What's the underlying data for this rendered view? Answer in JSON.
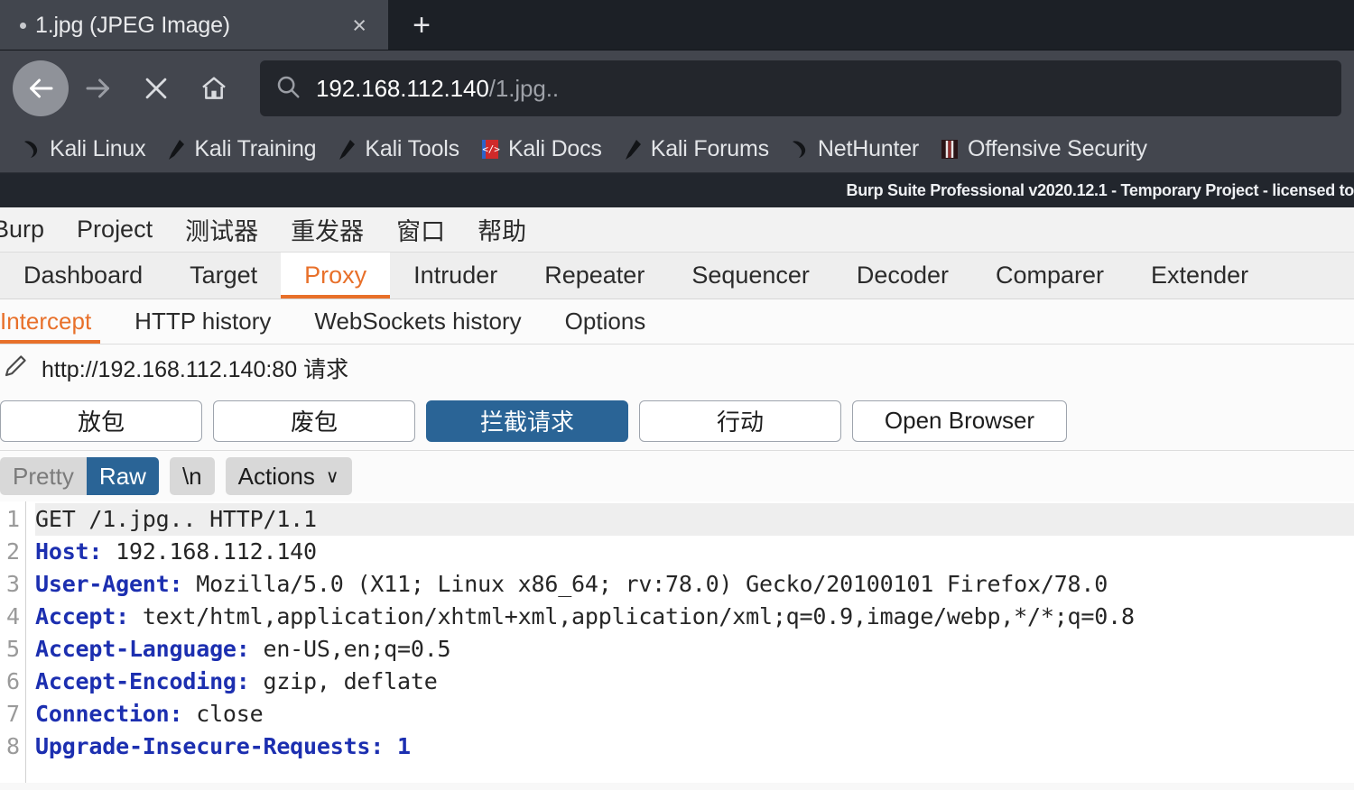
{
  "browser": {
    "tab": {
      "title": "1.jpg (JPEG Image)",
      "close_label": "×",
      "dot": "•"
    },
    "new_tab_label": "+",
    "nav": {
      "back": "back-arrow",
      "forward": "forward-arrow",
      "stop": "stop-x",
      "home": "home"
    },
    "url": {
      "host": "192.168.112.140",
      "path": "/1.jpg..",
      "search_icon": "search-icon"
    },
    "bookmarks": [
      {
        "label": "Kali Linux",
        "icon": "kali-dragon-icon"
      },
      {
        "label": "Kali Training",
        "icon": "kali-tool-icon"
      },
      {
        "label": "Kali Tools",
        "icon": "kali-tool-icon"
      },
      {
        "label": "Kali Docs",
        "icon": "kali-docs-icon"
      },
      {
        "label": "Kali Forums",
        "icon": "kali-tool-icon"
      },
      {
        "label": "NetHunter",
        "icon": "kali-dragon-icon"
      },
      {
        "label": "Offensive Security",
        "icon": "offsec-icon"
      }
    ]
  },
  "burp": {
    "window_title": "Burp Suite Professional v2020.12.1 - Temporary Project - licensed to",
    "menu": [
      "Burp",
      "Project",
      "测试器",
      "重发器",
      "窗口",
      "帮助"
    ],
    "main_tabs": [
      {
        "label": "Dashboard",
        "active": false
      },
      {
        "label": "Target",
        "active": false
      },
      {
        "label": "Proxy",
        "active": true
      },
      {
        "label": "Intruder",
        "active": false
      },
      {
        "label": "Repeater",
        "active": false
      },
      {
        "label": "Sequencer",
        "active": false
      },
      {
        "label": "Decoder",
        "active": false
      },
      {
        "label": "Comparer",
        "active": false
      },
      {
        "label": "Extender",
        "active": false
      }
    ],
    "sub_tabs": [
      {
        "label": "Intercept",
        "active": true
      },
      {
        "label": "HTTP history",
        "active": false
      },
      {
        "label": "WebSockets history",
        "active": false
      },
      {
        "label": "Options",
        "active": false
      }
    ],
    "request_target": {
      "icon": "pencil-icon",
      "text": "http://192.168.112.140:80 请求"
    },
    "actions": [
      {
        "label": "放包",
        "primary": false
      },
      {
        "label": "废包",
        "primary": false
      },
      {
        "label": "拦截请求",
        "primary": true
      },
      {
        "label": "行动",
        "primary": false
      },
      {
        "label": "Open Browser",
        "primary": false
      }
    ],
    "editor_toolbar": {
      "pretty": "Pretty",
      "raw": "Raw",
      "newline": "\\n",
      "actions": "Actions",
      "chevron": "∨"
    },
    "request_lines": [
      {
        "n": "1",
        "header": "",
        "value": "GET /1.jpg.. HTTP/1.1",
        "highlight": true
      },
      {
        "n": "2",
        "header": "Host:",
        "value": " 192.168.112.140",
        "highlight": false
      },
      {
        "n": "3",
        "header": "User-Agent:",
        "value": " Mozilla/5.0 (X11; Linux x86_64; rv:78.0) Gecko/20100101 Firefox/78.0",
        "highlight": false
      },
      {
        "n": "4",
        "header": "Accept:",
        "value": " text/html,application/xhtml+xml,application/xml;q=0.9,image/webp,*/*;q=0.8",
        "highlight": false
      },
      {
        "n": "5",
        "header": "Accept-Language:",
        "value": " en-US,en;q=0.5",
        "highlight": false
      },
      {
        "n": "6",
        "header": "Accept-Encoding:",
        "value": " gzip, deflate",
        "highlight": false
      },
      {
        "n": "7",
        "header": "Connection:",
        "value": " close",
        "highlight": false
      },
      {
        "n": "8",
        "header": "Upgrade-Insecure-Requests: 1",
        "value": "",
        "highlight": false
      }
    ]
  },
  "colors": {
    "accent_orange": "#e8702a",
    "primary_blue": "#2a6496",
    "header_blue": "#1c2fb0",
    "chrome_dark": "#1c2026",
    "chrome_gray": "#43464e"
  }
}
